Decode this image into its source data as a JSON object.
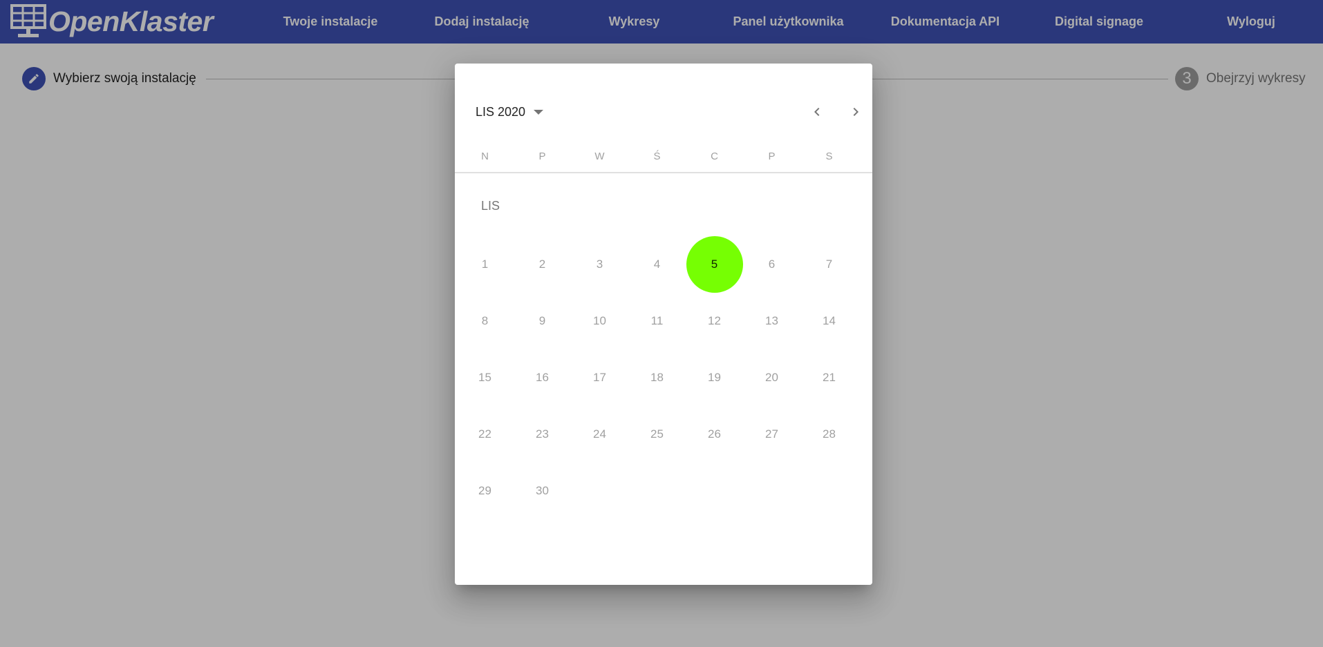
{
  "header": {
    "logo_text": "OpenKlaster",
    "nav": [
      {
        "label": "Twoje instalacje"
      },
      {
        "label": "Dodaj instalację"
      },
      {
        "label": "Wykresy"
      },
      {
        "label": "Panel użytkownika"
      },
      {
        "label": "Dokumentacja API"
      },
      {
        "label": "Digital signage"
      },
      {
        "label": "Wyloguj"
      }
    ],
    "colors": {
      "bar": "#3f51b5"
    }
  },
  "stepper": {
    "step1": {
      "label": "Wybierz swoją instalację",
      "icon": "pencil-icon"
    },
    "step3": {
      "number": "3",
      "label": "Obejrzyj wykresy"
    }
  },
  "datepicker": {
    "period_label": "LIS 2020",
    "month_label": "LIS",
    "weekdays": [
      "N",
      "P",
      "W",
      "Ś",
      "C",
      "P",
      "S"
    ],
    "weeks": [
      [
        "1",
        "2",
        "3",
        "4",
        "5",
        "6",
        "7"
      ],
      [
        "8",
        "9",
        "10",
        "11",
        "12",
        "13",
        "14"
      ],
      [
        "15",
        "16",
        "17",
        "18",
        "19",
        "20",
        "21"
      ],
      [
        "22",
        "23",
        "24",
        "25",
        "26",
        "27",
        "28"
      ],
      [
        "29",
        "30"
      ]
    ],
    "selected_day": "5",
    "colors": {
      "selected": "#76ff03"
    }
  }
}
